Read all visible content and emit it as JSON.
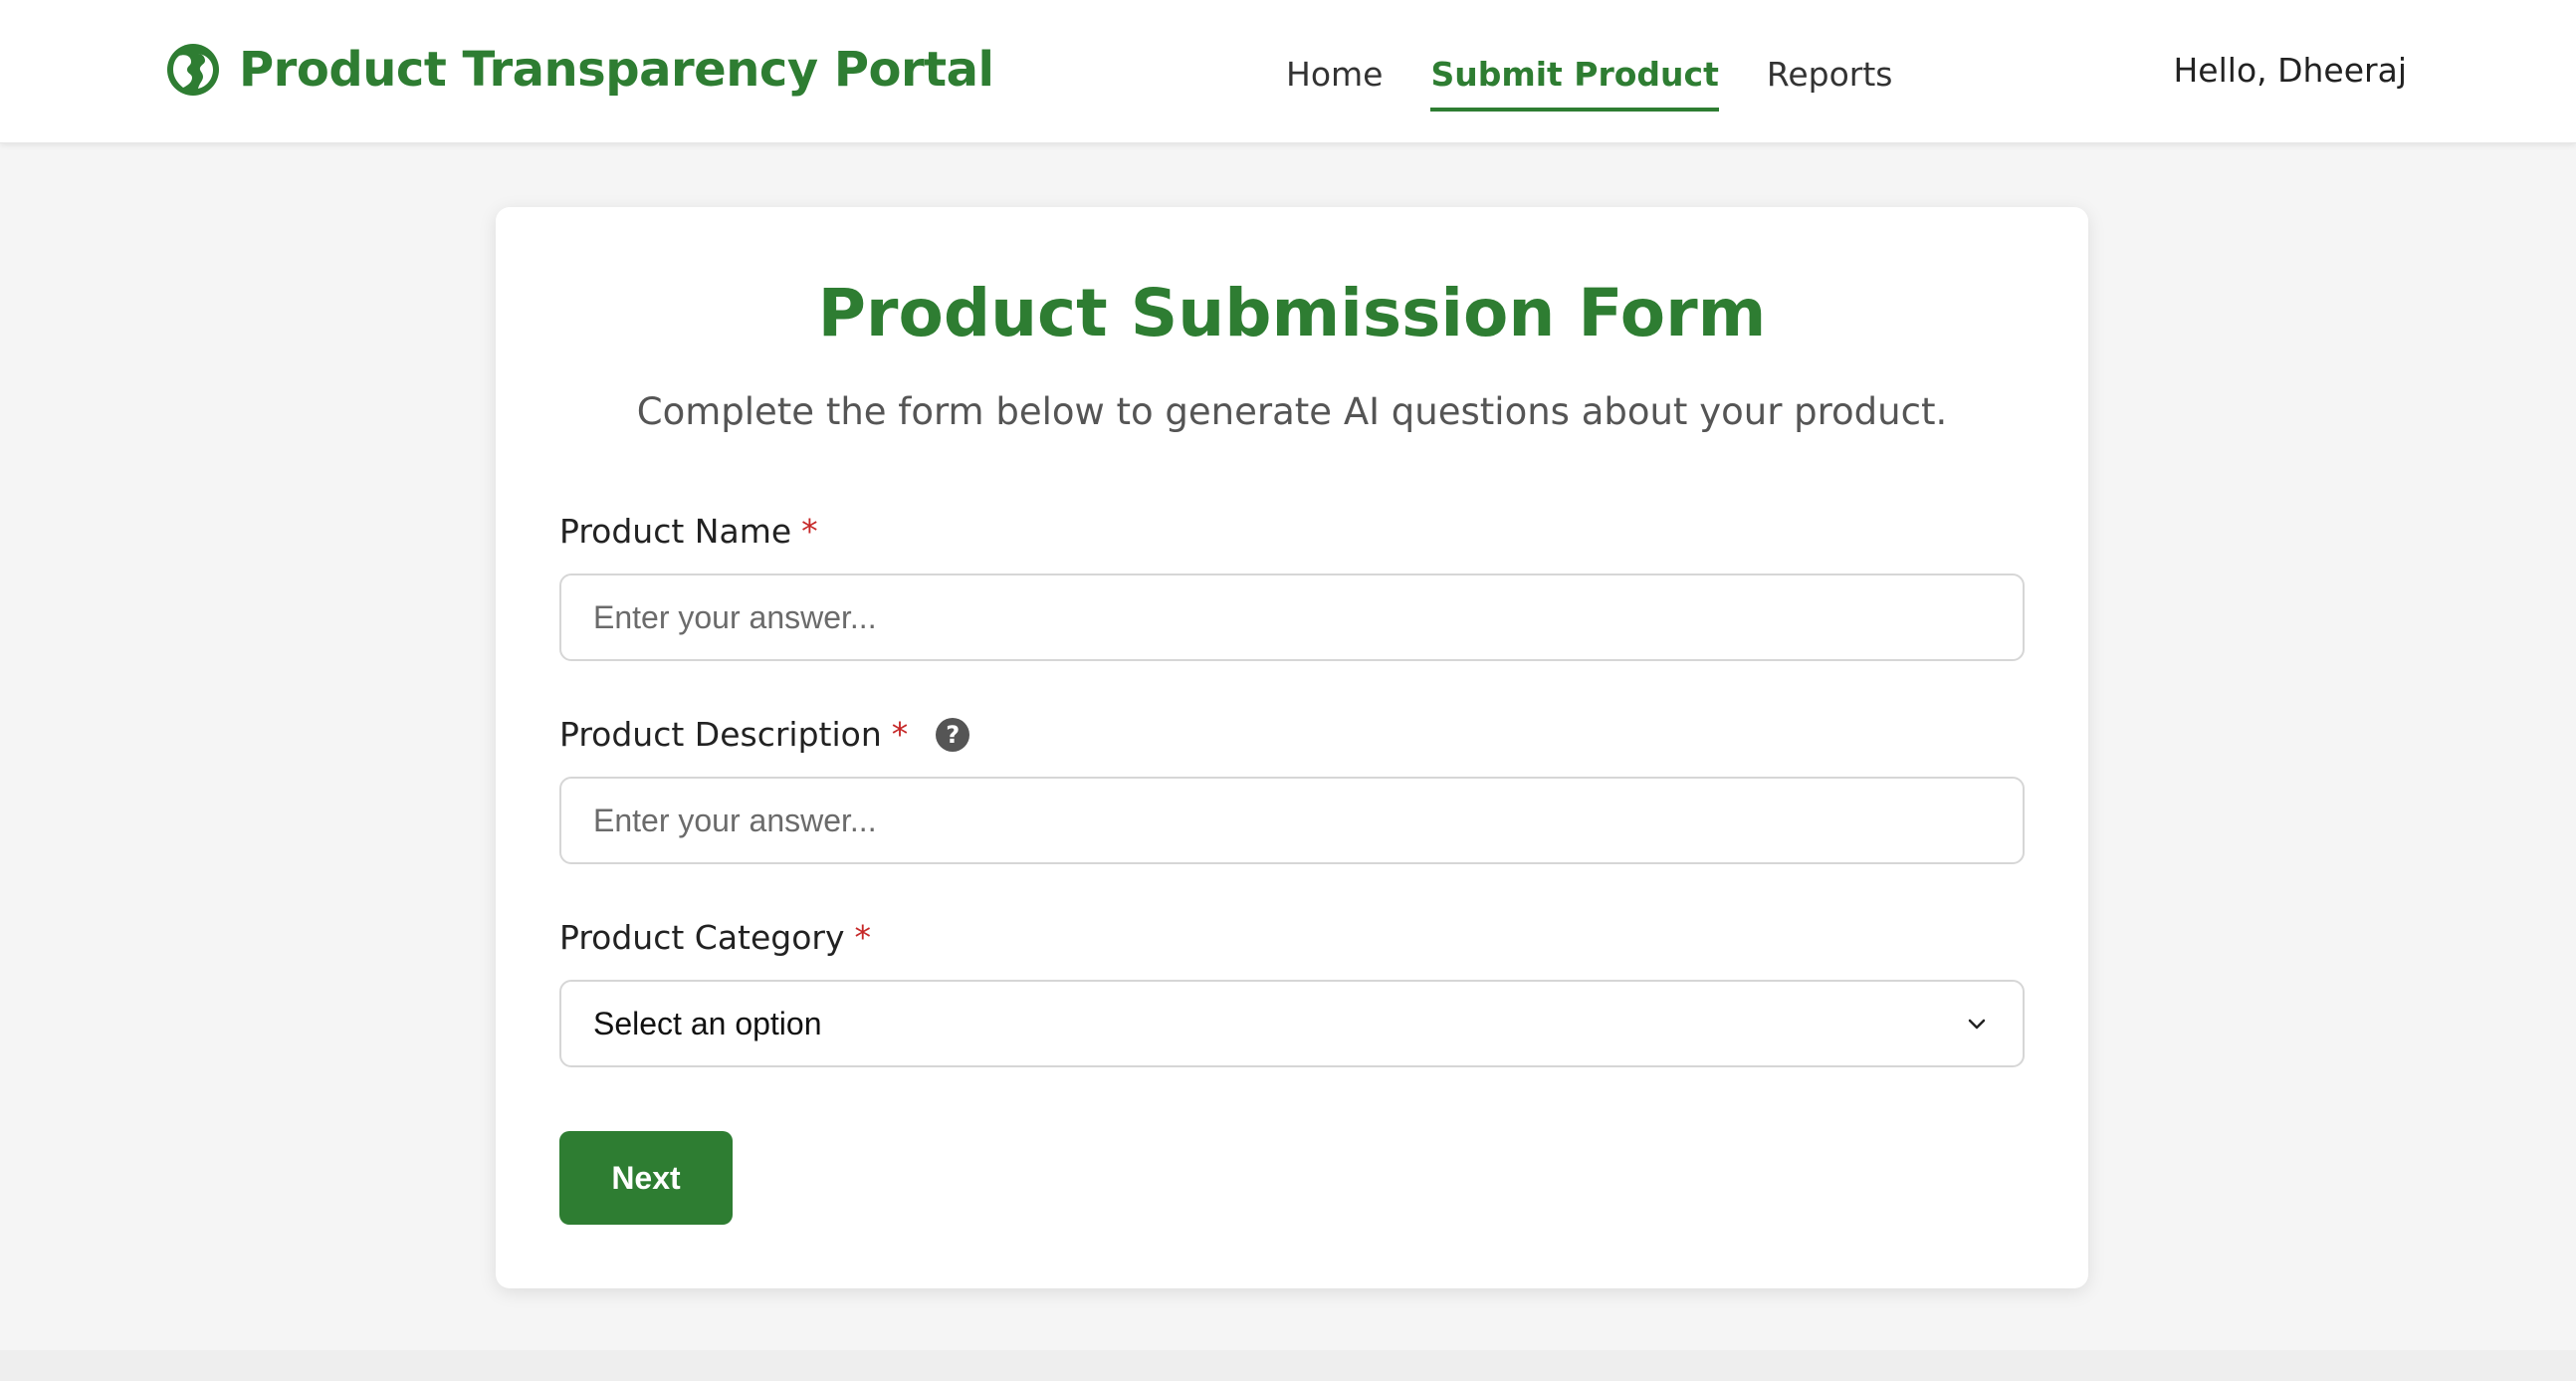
{
  "header": {
    "brand_title": "Product Transparency Portal",
    "brand_icon": "globe-icon",
    "nav": [
      {
        "label": "Home",
        "active": false
      },
      {
        "label": "Submit Product",
        "active": true
      },
      {
        "label": "Reports",
        "active": false
      }
    ],
    "greeting": "Hello, Dheeraj"
  },
  "form": {
    "title": "Product Submission Form",
    "subtitle": "Complete the form below to generate AI questions about your product.",
    "fields": [
      {
        "label": "Product Name",
        "required_mark": "*",
        "placeholder": "Enter your answer..."
      },
      {
        "label": "Product Description",
        "required_mark": "*",
        "placeholder": "Enter your answer...",
        "help_icon": "question-circle-icon",
        "help_glyph": "?"
      },
      {
        "label": "Product Category",
        "required_mark": "*",
        "selected": "Select an option"
      }
    ],
    "next_label": "Next"
  },
  "colors": {
    "brand_green": "#2e7d32",
    "required_red": "#c62828",
    "background": "#f5f5f5"
  }
}
